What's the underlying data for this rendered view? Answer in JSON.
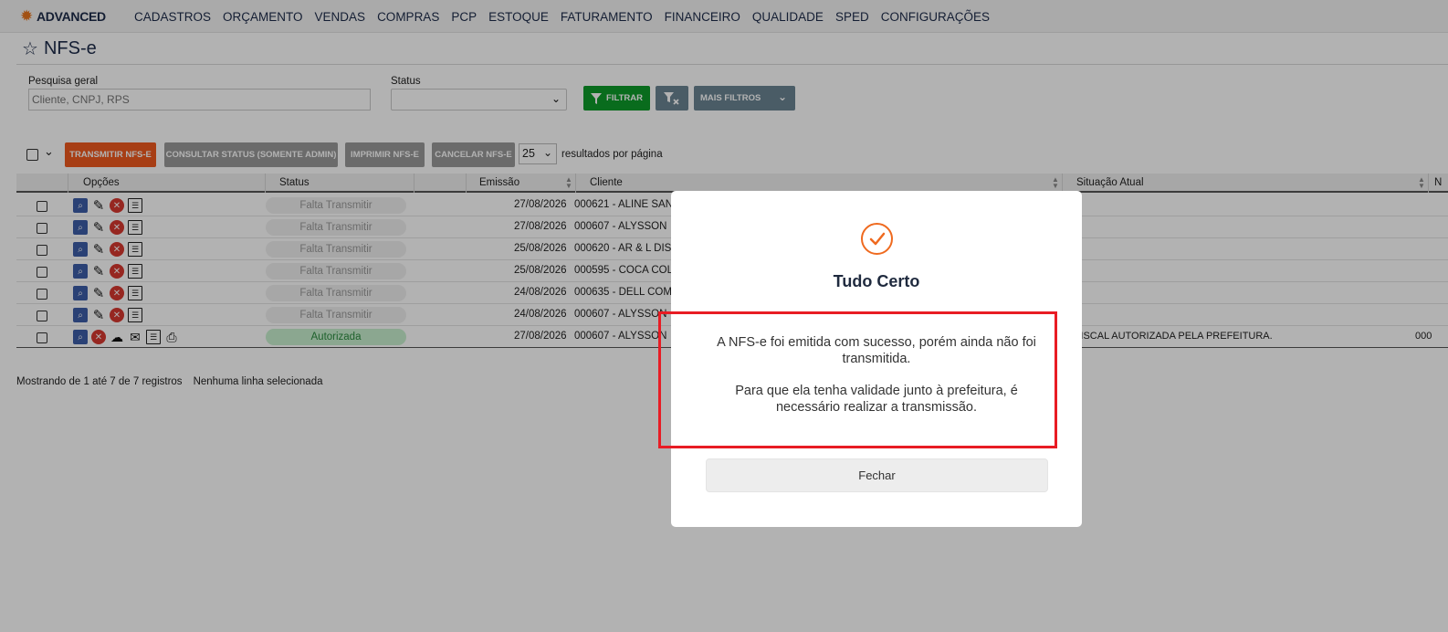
{
  "app": {
    "logo_text": "ADVANCED"
  },
  "nav": [
    "CADASTROS",
    "ORÇAMENTO",
    "VENDAS",
    "COMPRAS",
    "PCP",
    "ESTOQUE",
    "FATURAMENTO",
    "FINANCEIRO",
    "QUALIDADE",
    "SPED",
    "CONFIGURAÇÕES"
  ],
  "page": {
    "title": "NFS-e"
  },
  "filters": {
    "search_label": "Pesquisa geral",
    "search_placeholder": "Cliente, CNPJ, RPS",
    "search_value": "",
    "status_label": "Status",
    "status_value": "",
    "filter_button": "FILTRAR",
    "more_filters_button": "MAIS FILTROS"
  },
  "actions": {
    "transmit": "TRANSMITIR NFS-E",
    "check_status": "CONSULTAR STATUS (SOMENTE ADMIN)",
    "print": "IMPRIMIR NFS-E",
    "cancel": "CANCELAR NFS-E",
    "per_page_value": "25",
    "per_page_label": "resultados por página"
  },
  "table": {
    "headers": {
      "options": "Opções",
      "status": "Status",
      "emission": "Emissão",
      "client": "Cliente",
      "situation": "Situação Atual",
      "n": "N"
    },
    "rows": [
      {
        "status": "Falta Transmitir",
        "date": "27/08/2026",
        "client": "000621 - ALINE SAN",
        "situation": "",
        "n": ""
      },
      {
        "status": "Falta Transmitir",
        "date": "27/08/2026",
        "client": "000607 - ALYSSON",
        "situation": "",
        "n": ""
      },
      {
        "status": "Falta Transmitir",
        "date": "25/08/2026",
        "client": "000620 - AR & L DIS",
        "situation": "",
        "n": ""
      },
      {
        "status": "Falta Transmitir",
        "date": "25/08/2026",
        "client": "000595 - COCA COL",
        "situation": "",
        "n": ""
      },
      {
        "status": "Falta Transmitir",
        "date": "24/08/2026",
        "client": "000635 - DELL COM",
        "situation": "",
        "n": ""
      },
      {
        "status": "Falta Transmitir",
        "date": "24/08/2026",
        "client": "000607 - ALYSSON",
        "situation": "",
        "n": ""
      },
      {
        "status": "Autorizada",
        "date": "27/08/2026",
        "client": "000607 - ALYSSON",
        "situation": "TA FISCAL AUTORIZADA PELA PREFEITURA.",
        "n": "000"
      }
    ]
  },
  "footer": {
    "showing": "Mostrando de 1 até 7 de 7 registros",
    "selection": "Nenhuma linha selecionada"
  },
  "modal": {
    "title": "Tudo Certo",
    "message_1": "A NFS-e foi emitida com sucesso, porém ainda não foi transmitida.",
    "message_2": "Para que ela tenha validade junto à prefeitura, é necessário realizar a transmissão.",
    "close_button": "Fechar",
    "accent_color": "#ef6a1f",
    "highlight_color": "#e81c24"
  }
}
